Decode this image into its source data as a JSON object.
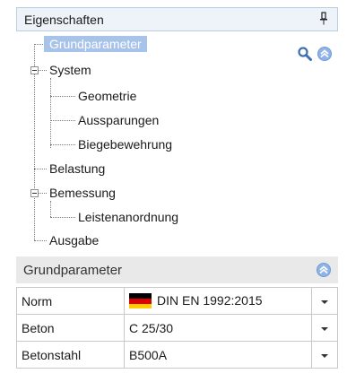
{
  "panel": {
    "title": "Eigenschaften",
    "pin_icon": "pin-icon"
  },
  "tree": {
    "items": [
      {
        "label": "Grundparameter",
        "selected": true
      },
      {
        "label": "System",
        "expanded": true
      },
      {
        "label": "Geometrie"
      },
      {
        "label": "Aussparungen"
      },
      {
        "label": "Biegebewehrung"
      },
      {
        "label": "Belastung"
      },
      {
        "label": "Bemessung",
        "expanded": true
      },
      {
        "label": "Leistenanordnung"
      },
      {
        "label": "Ausgabe"
      }
    ],
    "search_icon": "search-icon",
    "collapse_icon": "collapse-up-icon"
  },
  "section": {
    "title": "Grundparameter",
    "collapse_icon": "collapse-up-icon"
  },
  "grid": {
    "rows": [
      {
        "key": "Norm",
        "value": "DIN EN 1992:2015",
        "flag": "germany-flag-icon"
      },
      {
        "key": "Beton",
        "value": "C 25/30"
      },
      {
        "key": "Betonstahl",
        "value": "B500A"
      }
    ]
  },
  "colors": {
    "accent": "#a8c3ea",
    "header_bg": "#eef3fa",
    "header_border": "#b9cde3",
    "section_bg": "#e9e9e9",
    "icon_blue": "#3d6fb5"
  }
}
